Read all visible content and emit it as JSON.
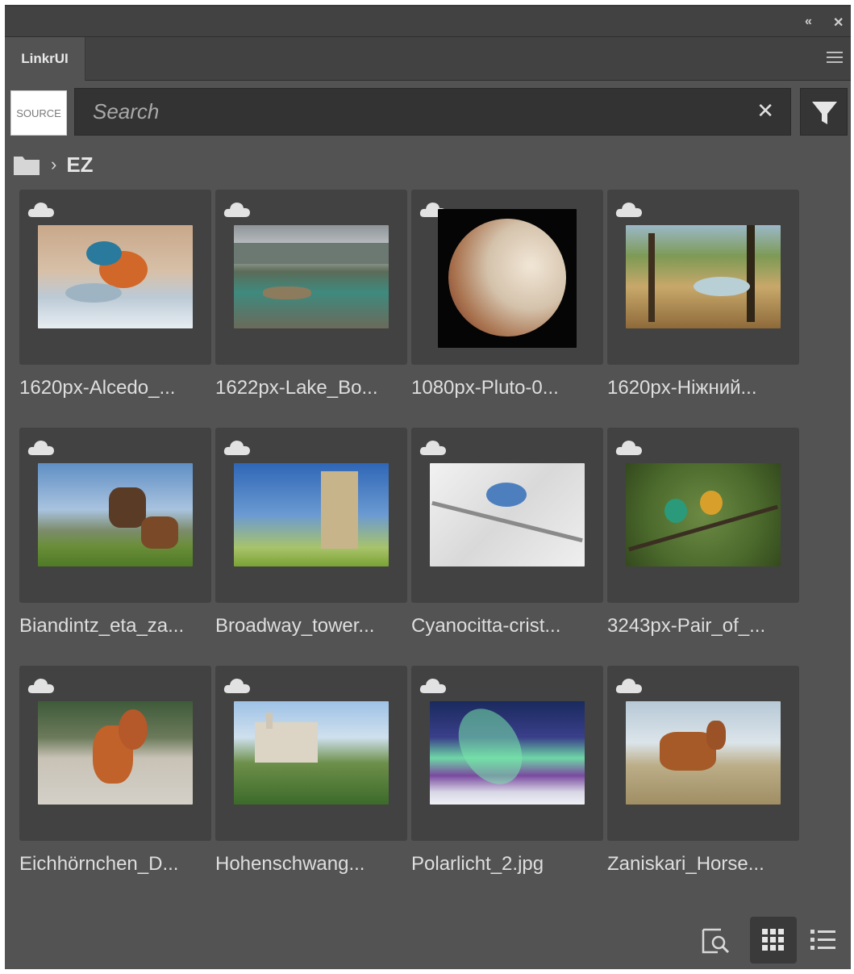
{
  "tab": {
    "label": "LinkrUI"
  },
  "source_button": {
    "label": "SOURCE"
  },
  "search": {
    "placeholder": "Search",
    "value": ""
  },
  "breadcrumb": {
    "current": "EZ"
  },
  "items": [
    {
      "label": "1620px-Alcedo_...",
      "icon": "cloud-icon"
    },
    {
      "label": "1622px-Lake_Bo...",
      "icon": "cloud-icon"
    },
    {
      "label": "1080px-Pluto-0...",
      "icon": "cloud-icon"
    },
    {
      "label": "1620px-Ніжний...",
      "icon": "cloud-icon"
    },
    {
      "label": "Biandintz_eta_za...",
      "icon": "cloud-icon"
    },
    {
      "label": "Broadway_tower...",
      "icon": "cloud-icon"
    },
    {
      "label": "Cyanocitta-crist...",
      "icon": "cloud-icon"
    },
    {
      "label": "3243px-Pair_of_...",
      "icon": "cloud-icon"
    },
    {
      "label": "Eichhörnchen_D...",
      "icon": "cloud-icon"
    },
    {
      "label": "Hohenschwang...",
      "icon": "cloud-icon"
    },
    {
      "label": "Polarlicht_2.jpg",
      "icon": "cloud-icon"
    },
    {
      "label": "Zaniskari_Horse...",
      "icon": "cloud-icon"
    }
  ],
  "view_mode": "grid",
  "colors": {
    "panel_bg": "#535353",
    "tile_bg": "#424242",
    "search_bg": "#333333",
    "text": "#dedede"
  }
}
